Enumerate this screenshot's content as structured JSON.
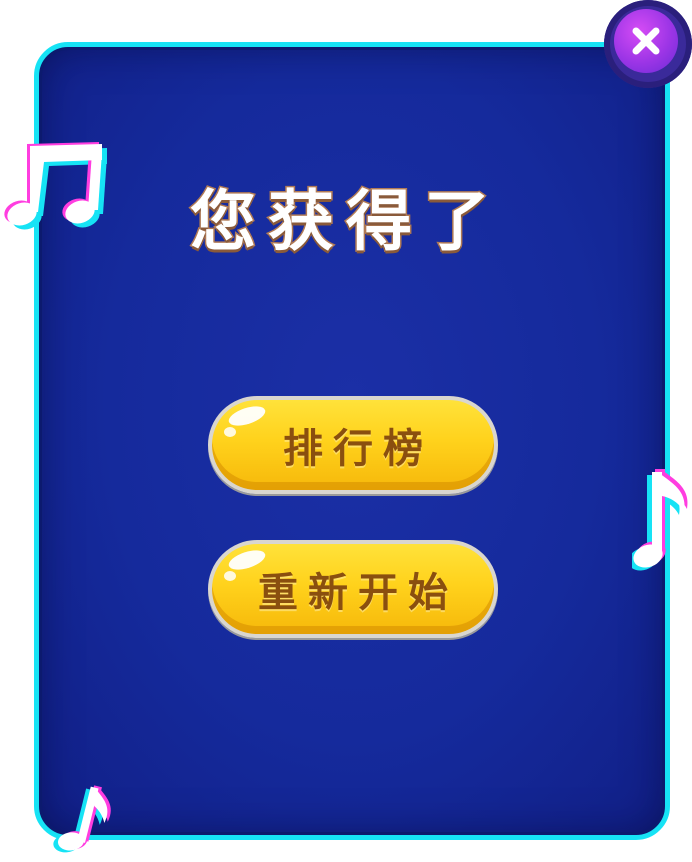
{
  "dialog": {
    "title": "您获得了",
    "buttons": {
      "leaderboard_label": "排行榜",
      "restart_label": "重新开始"
    },
    "close_icon": "close-icon"
  },
  "decorations": {
    "icons": [
      "music-note-icon",
      "music-note-icon",
      "music-note-icon"
    ]
  },
  "colors": {
    "panel_fill": "#152a9c",
    "panel_border": "#16e3f5",
    "title_text": "#ffffff",
    "title_outline": "#b07a55",
    "button_fill": "#ffd21c",
    "button_text": "#8a4f0f",
    "close_fill": "#9c35e6",
    "note_pink": "#ff3de0",
    "note_cyan": "#16e3f5"
  }
}
